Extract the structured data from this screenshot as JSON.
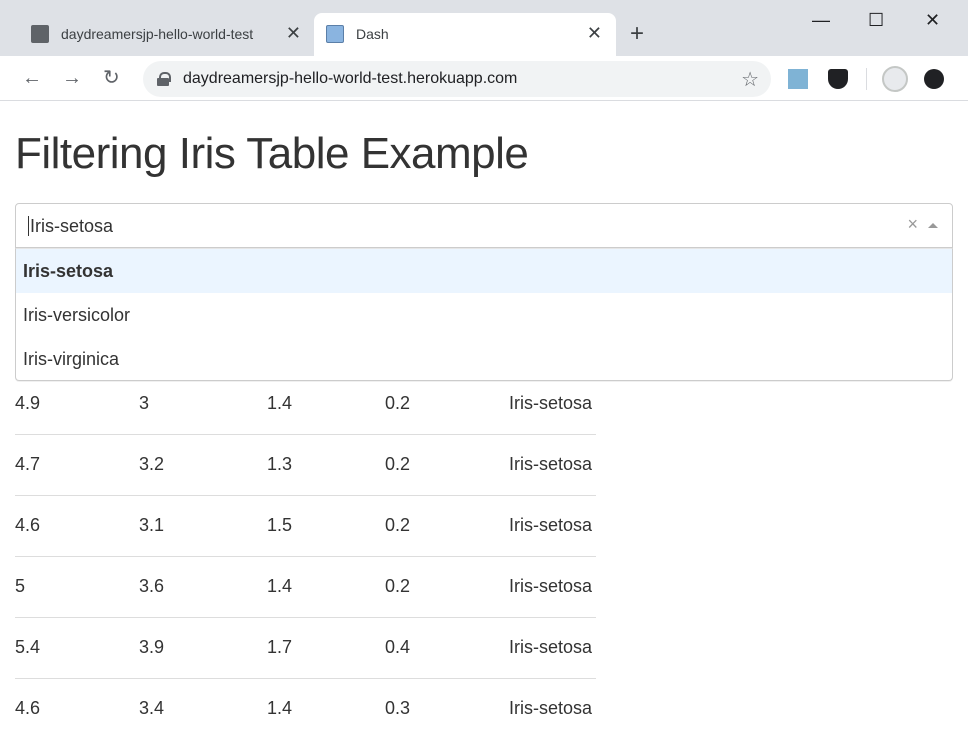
{
  "browser": {
    "tabs": [
      {
        "title": "daydreamersjp-hello-world-test",
        "close": "✕",
        "active": false
      },
      {
        "title": "Dash",
        "close": "✕",
        "active": true
      }
    ],
    "new_tab": "+",
    "window": {
      "minimize": "—",
      "maximize": "☐",
      "close": "✕"
    },
    "url": "daydreamersjp-hello-world-test.herokuapp.com"
  },
  "page": {
    "title": "Filtering Iris Table Example",
    "dropdown": {
      "value": "Iris-setosa",
      "clear": "×",
      "options": [
        "Iris-setosa",
        "Iris-versicolor",
        "Iris-virginica"
      ],
      "focused_option": "Iris-setosa"
    },
    "table": {
      "rows": [
        [
          "4.9",
          "3",
          "1.4",
          "0.2",
          "Iris-setosa"
        ],
        [
          "4.7",
          "3.2",
          "1.3",
          "0.2",
          "Iris-setosa"
        ],
        [
          "4.6",
          "3.1",
          "1.5",
          "0.2",
          "Iris-setosa"
        ],
        [
          "5",
          "3.6",
          "1.4",
          "0.2",
          "Iris-setosa"
        ],
        [
          "5.4",
          "3.9",
          "1.7",
          "0.4",
          "Iris-setosa"
        ],
        [
          "4.6",
          "3.4",
          "1.4",
          "0.3",
          "Iris-setosa"
        ]
      ]
    }
  }
}
